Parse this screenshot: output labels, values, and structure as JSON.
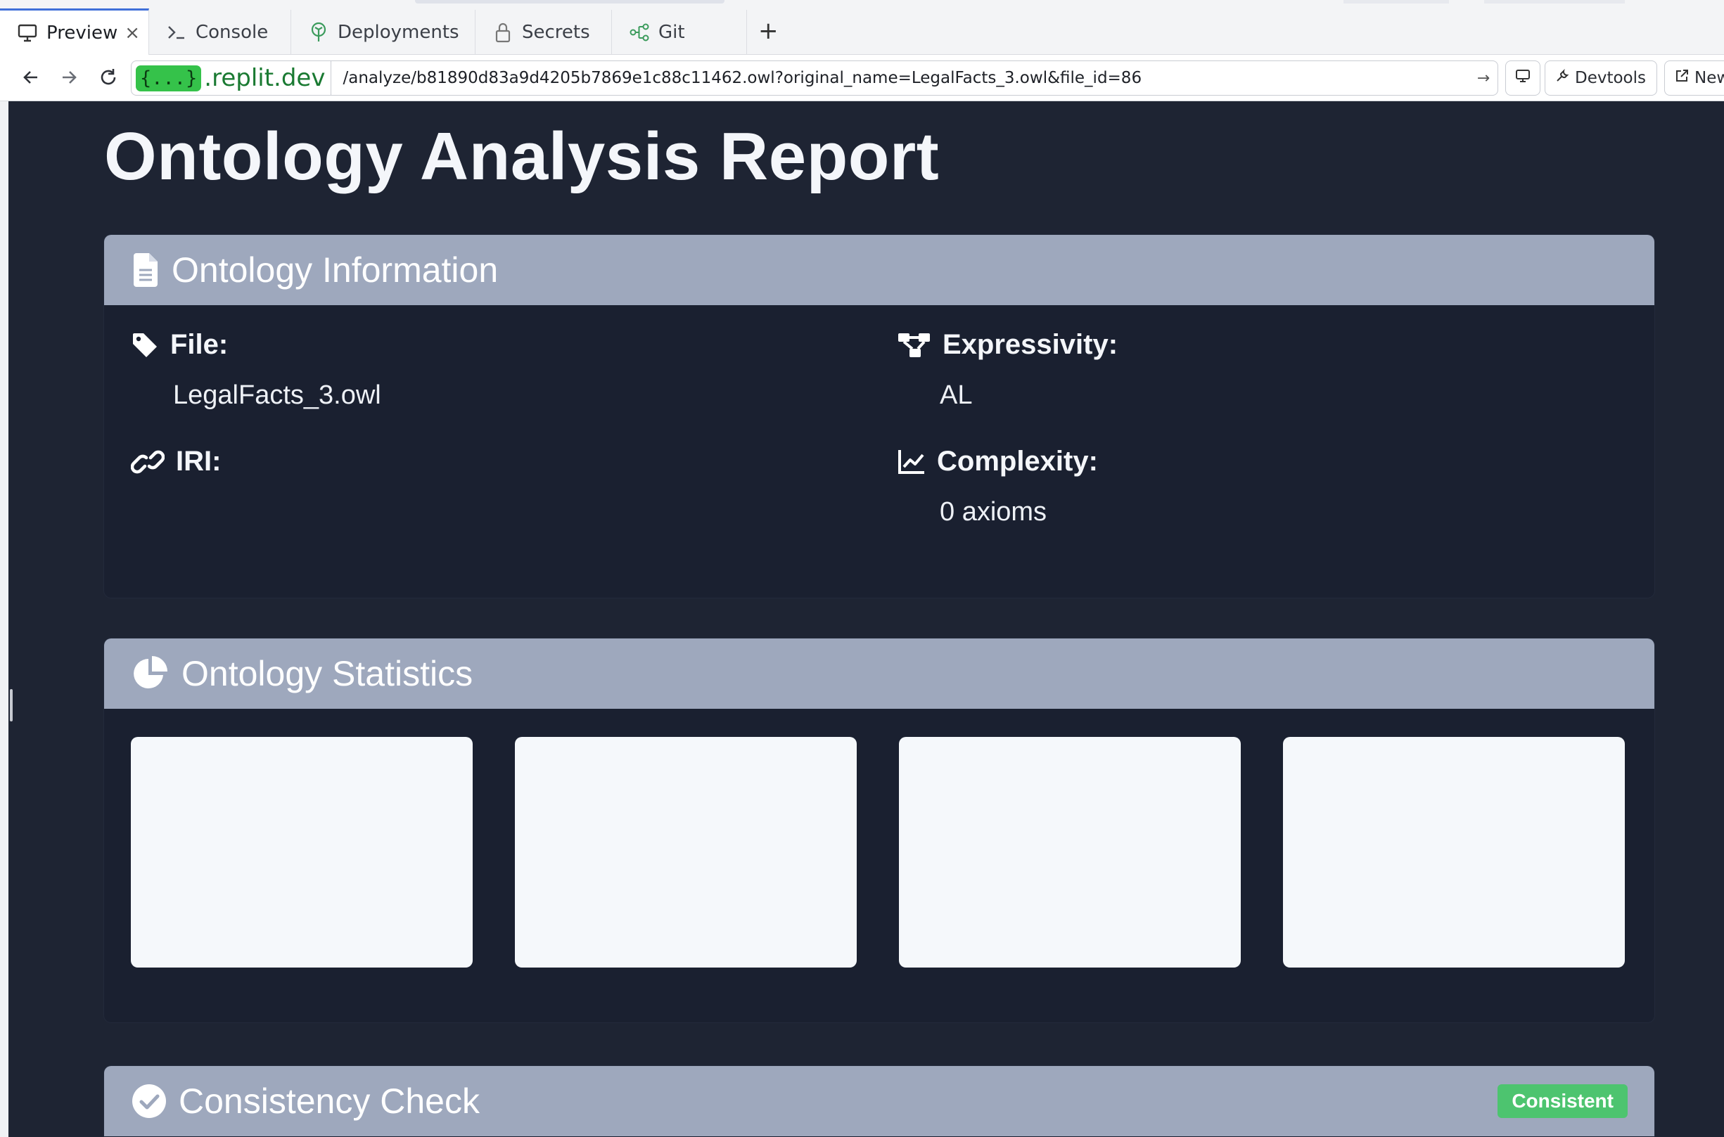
{
  "browser": {
    "tabs": [
      {
        "label": "Preview",
        "icon": "monitor-icon",
        "active": true
      },
      {
        "label": "Console",
        "icon": "terminal-icon",
        "active": false
      },
      {
        "label": "Deployments",
        "icon": "deployments-icon",
        "active": false
      },
      {
        "label": "Secrets",
        "icon": "lock-icon",
        "active": false
      },
      {
        "label": "Git",
        "icon": "git-branch-icon",
        "active": false
      }
    ],
    "close_glyph": "×",
    "new_tab_glyph": "+",
    "badge_text": "{...}",
    "domain": ".replit.dev",
    "url_path": "/analyze/b81890d83a9d4205b7869e1c88c11462.owl?original_name=LegalFacts_3.owl&file_id=86",
    "devtools_label": "Devtools",
    "new_window_label": "New"
  },
  "report": {
    "title": "Ontology Analysis Report",
    "info": {
      "heading": "Ontology Information",
      "file_label": "File:",
      "file_value": "LegalFacts_3.owl",
      "iri_label": "IRI:",
      "iri_value": "",
      "expressivity_label": "Expressivity:",
      "expressivity_value": "AL",
      "complexity_label": "Complexity:",
      "complexity_value": "0 axioms"
    },
    "statistics": {
      "heading": "Ontology Statistics",
      "boxes": 4
    },
    "consistency": {
      "heading": "Consistency Check",
      "status": "Consistent",
      "status_color": "#4dc46f"
    }
  },
  "colors": {
    "page_bg": "#1e2433",
    "card_header": "#9ea8bd",
    "replit_green": "#35c24a"
  }
}
